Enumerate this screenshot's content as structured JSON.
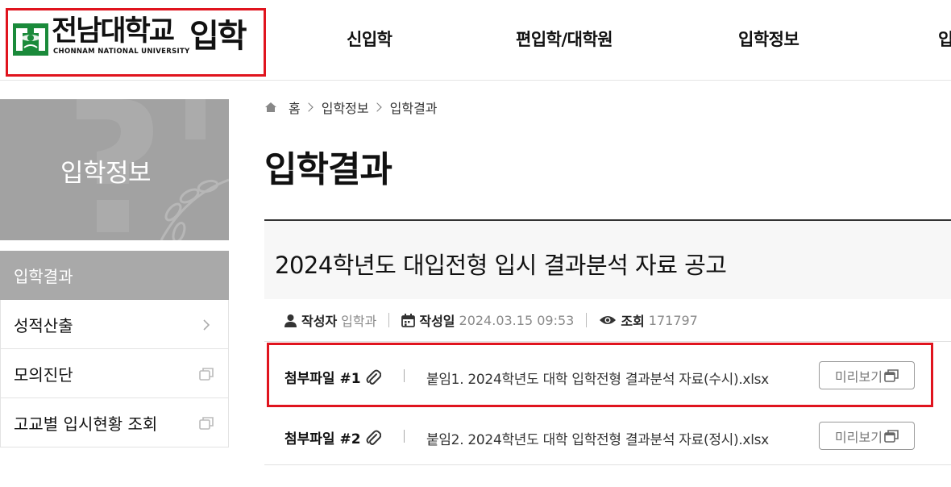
{
  "header": {
    "logo_name": "전남대학교",
    "logo_english": "CHONNAM NATIONAL UNIVERSITY",
    "logo_suffix": "입학",
    "nav": [
      "신입학",
      "편입학/대학원",
      "입학정보",
      "입"
    ]
  },
  "sidebar": {
    "banner_title": "입학정보",
    "items": [
      {
        "label": "입학결과",
        "active": true,
        "icon": ""
      },
      {
        "label": "성적산출",
        "active": false,
        "icon": "chevron-right-icon"
      },
      {
        "label": "모의진단",
        "active": false,
        "icon": "new-window-icon"
      },
      {
        "label": "고교별 입시현황 조회",
        "active": false,
        "icon": "new-window-icon"
      }
    ]
  },
  "breadcrumb": [
    "홈",
    "입학정보",
    "입학결과"
  ],
  "page_title": "입학결과",
  "post": {
    "title": "2024학년도 대입전형 입시 결과분석 자료 공고",
    "meta": {
      "author_label": "작성자",
      "author": "입학과",
      "date_label": "작성일",
      "date": "2024.03.15 09:53",
      "views_label": "조회",
      "views": "171797"
    },
    "attachments": [
      {
        "label": "첨부파일 #1",
        "file": "붙임1. 2024학년도 대학 입학전형 결과분석 자료(수시).xlsx",
        "preview": "미리보기"
      },
      {
        "label": "첨부파일 #2",
        "file": "붙임2. 2024학년도 대학 입학전형 결과분석 자료(정시).xlsx",
        "preview": "미리보기"
      }
    ]
  },
  "colors": {
    "highlight": "#e0141e",
    "sidebar_active": "#a9a9a9",
    "logo_green": "#1a8a3a"
  }
}
